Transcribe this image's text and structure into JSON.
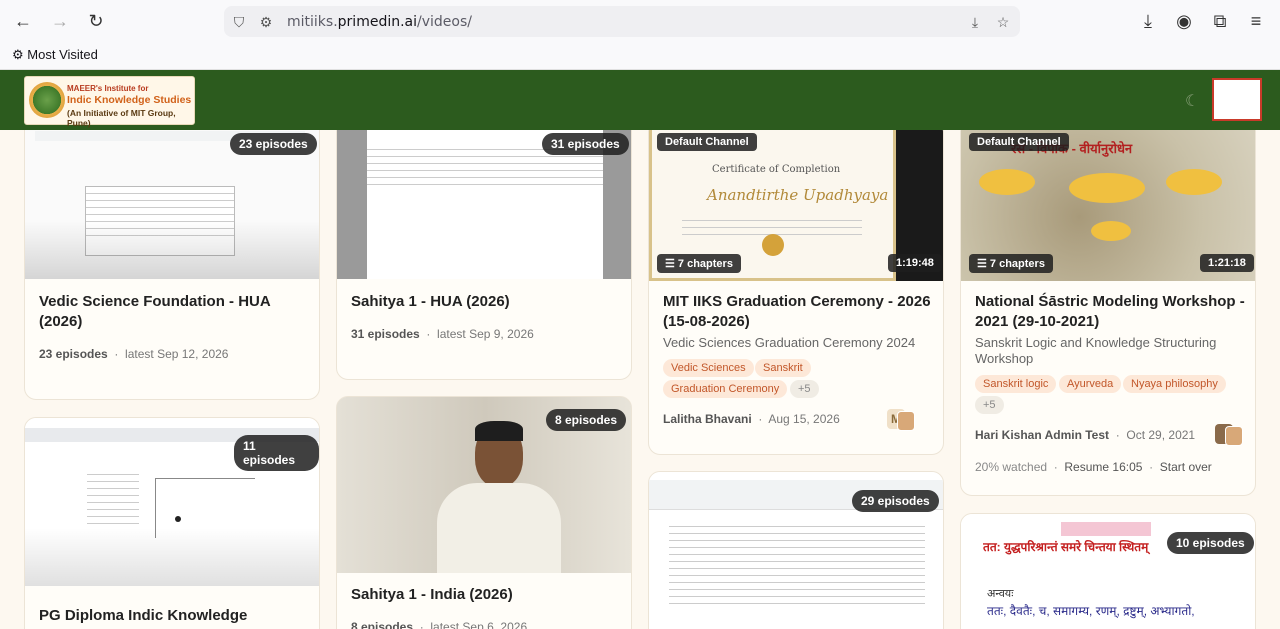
{
  "browser": {
    "url_prefix": "mitiiks.",
    "url_domain": "primedin.ai",
    "url_path": "/videos/",
    "bookmark": "Most Visited"
  },
  "header": {
    "logo_line1": "MAEER's Institute for",
    "logo_line2": "Indic Knowledge Studies",
    "logo_line3": "(An Initiative of MIT Group, Pune)"
  },
  "cards": [
    {
      "title": "Vedic Science Foundation - HUA (2026)",
      "badge": "23 episodes",
      "episodes": "23 episodes",
      "latest": "latest Sep 12, 2026"
    },
    {
      "title": "Sahitya 1 - HUA (2026)",
      "badge": "31 episodes",
      "episodes": "31 episodes",
      "latest": "latest Sep 9, 2026"
    },
    {
      "title": "MIT IIKS Graduation Ceremony - 2026 (15-08-2026)",
      "channel": "Default Channel",
      "chapters": "7 chapters",
      "duration": "1:19:48",
      "subtitle": "Vedic Sciences Graduation Ceremony 2024",
      "tags": [
        "Vedic Sciences",
        "Sanskrit",
        "Graduation Ceremony",
        "+5"
      ],
      "author": "Lalitha Bhavani",
      "date": "Aug 15, 2026",
      "initial": "M",
      "cert_title": "Certificate of Completion",
      "cert_name": "Anandtirthe Upadhyaya"
    },
    {
      "title": "National Śāstric Modeling Workshop - 2021 (29-10-2021)",
      "channel": "Default Channel",
      "chapters": "7 chapters",
      "duration": "1:21:18",
      "subtitle": "Sanskrit Logic and Knowledge Structuring Workshop",
      "tags": [
        "Sanskrit logic",
        "Ayurveda",
        "Nyaya philosophy",
        "+5"
      ],
      "author": "Hari Kishan Admin Test",
      "date": "Oct 29, 2021",
      "watched": "20% watched",
      "resume": "Resume 16:05",
      "start_over": "Start over",
      "thumb_text": "रस - विपाक - वीर्यानुरोधेन"
    },
    {
      "title": "PG Diploma Indic Knowledge",
      "badge": "11 episodes"
    },
    {
      "title": "Sahitya 1 - India (2026)",
      "badge": "8 episodes",
      "episodes": "8 episodes",
      "latest": "latest Sep 6, 2026"
    },
    {
      "title": "",
      "badge": "29 episodes"
    },
    {
      "title": "",
      "badge": "10 episodes",
      "thumb_line1": "तत: युद्धपरिश्रान्तं समरे चिन्तया स्थितम्",
      "thumb_line2": "अन्वयः",
      "thumb_line3": "ततः, दैवतैः, च, समागम्य, रणम्, द्रष्टुम्, अभ्यागतो,"
    }
  ],
  "colors": {
    "header": "#2c5b1e",
    "tag_bg": "#fde8d8",
    "tag_fg": "#c2572a",
    "avatar_border": "#c93a2a"
  }
}
